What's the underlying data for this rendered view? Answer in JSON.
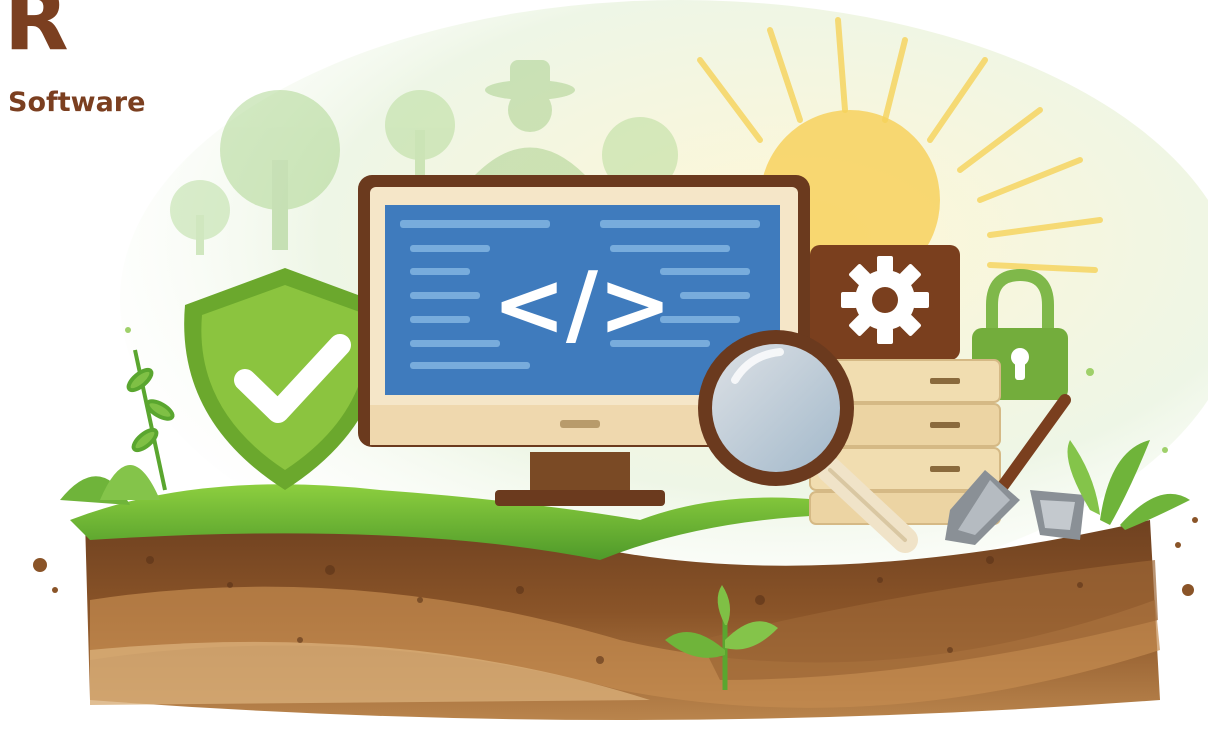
{
  "brand": {
    "letter": "R",
    "word": "Software"
  },
  "illustration": {
    "code_symbol": "</>",
    "icons": [
      "shield-check-icon",
      "code-monitor-icon",
      "gear-icon",
      "padlock-icon",
      "magnifier-icon",
      "server-stack-icon",
      "trowel-icon",
      "sun-icon",
      "seedling-icon"
    ],
    "colors": {
      "brand": "#7b3f20",
      "screen": "#3f7bbd",
      "shield": "#7fb93a",
      "soil": "#7a4a25",
      "sun": "#f7d15e"
    }
  }
}
